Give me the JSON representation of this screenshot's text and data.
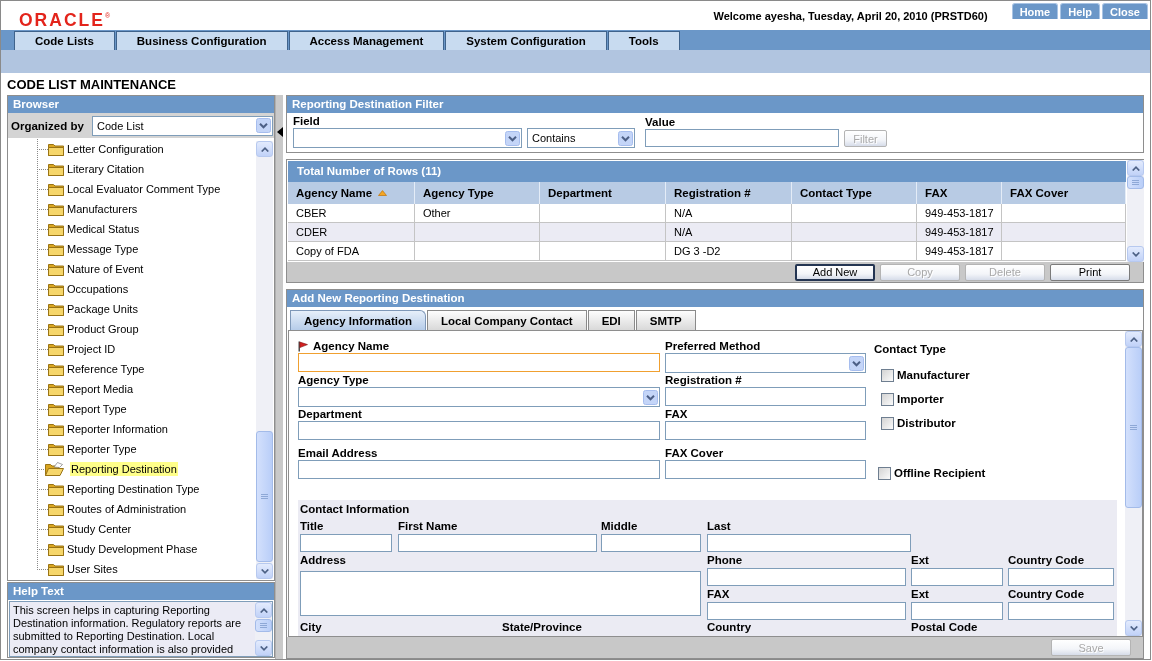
{
  "header": {
    "logo": "ORACLE$^{®}$",
    "welcome": "Welcome ayesha, Tuesday, April 20, 2010 (PRSTD60)",
    "links": [
      "Home",
      "Help",
      "Close"
    ]
  },
  "menu": [
    "Code Lists",
    "Business Configuration",
    "Access Management",
    "System Configuration",
    "Tools"
  ],
  "page_title": "CODE LIST MAINTENANCE",
  "browser": {
    "title": "Browser",
    "organized_by": {
      "label": "Organized by",
      "value": "Code List"
    },
    "items": [
      {
        "label": "Letter Configuration",
        "selected": false
      },
      {
        "label": "Literary Citation",
        "selected": false
      },
      {
        "label": "Local Evaluator Comment Type",
        "selected": false
      },
      {
        "label": "Manufacturers",
        "selected": false
      },
      {
        "label": "Medical Status",
        "selected": false
      },
      {
        "label": "Message Type",
        "selected": false
      },
      {
        "label": "Nature of Event",
        "selected": false
      },
      {
        "label": "Occupations",
        "selected": false
      },
      {
        "label": "Package Units",
        "selected": false
      },
      {
        "label": "Product Group",
        "selected": false
      },
      {
        "label": "Project ID",
        "selected": false
      },
      {
        "label": "Reference Type",
        "selected": false
      },
      {
        "label": "Report Media",
        "selected": false
      },
      {
        "label": "Report Type",
        "selected": false
      },
      {
        "label": "Reporter Information",
        "selected": false
      },
      {
        "label": "Reporter Type",
        "selected": false
      },
      {
        "label": "Reporting Destination",
        "selected": true
      },
      {
        "label": "Reporting Destination Type",
        "selected": false
      },
      {
        "label": "Routes of Administration",
        "selected": false
      },
      {
        "label": "Study Center",
        "selected": false
      },
      {
        "label": "Study Development Phase",
        "selected": false
      },
      {
        "label": "User Sites",
        "selected": false
      }
    ]
  },
  "help": {
    "title": "Help Text",
    "text": "This screen helps in capturing Reporting Destination information. Regulatory reports are submitted to Reporting Destination. Local company contact information is also provided"
  },
  "filter": {
    "title": "Reporting Destination Filter",
    "field_label": "Field",
    "operator": "Contains",
    "value_label": "Value",
    "button": {
      "label": "Filter",
      "disabled": true
    }
  },
  "table": {
    "title": "Total Number of Rows (11)",
    "columns": [
      {
        "label": "Agency Name",
        "sorted": true
      },
      {
        "label": "Agency Type",
        "sorted": false
      },
      {
        "label": "Department",
        "sorted": false
      },
      {
        "label": "Registration #",
        "sorted": false
      },
      {
        "label": "Contact Type",
        "sorted": false
      },
      {
        "label": "FAX",
        "sorted": false
      },
      {
        "label": "FAX Cover",
        "sorted": false
      }
    ],
    "rows": [
      [
        "CBER",
        "Other",
        null,
        "N/A",
        null,
        "949-453-1817",
        null
      ],
      [
        "CDER",
        null,
        null,
        "N/A",
        null,
        "949-453-1817",
        null
      ],
      [
        "Copy of FDA",
        null,
        null,
        "DG 3 -D2",
        null,
        "949-453-1817",
        null
      ]
    ],
    "buttons": [
      {
        "label": "Add New",
        "disabled": false,
        "focused": true
      },
      {
        "label": "Copy",
        "disabled": true,
        "focused": false
      },
      {
        "label": "Delete",
        "disabled": true,
        "focused": false
      },
      {
        "label": "Print",
        "disabled": false,
        "focused": false
      }
    ]
  },
  "form": {
    "title": "Add New Reporting Destination",
    "tabs": [
      {
        "label": "Agency Information",
        "selected": true
      },
      {
        "label": "Local Company Contact",
        "selected": false
      },
      {
        "label": "EDI",
        "selected": false
      },
      {
        "label": "SMTP",
        "selected": false
      }
    ],
    "fields": [
      {
        "label": "Agency Name",
        "kind": "text",
        "required": true,
        "focused": true
      },
      {
        "label": "Preferred Method",
        "kind": "select",
        "required": false,
        "focused": false
      },
      {
        "label": "Agency Type",
        "kind": "select",
        "required": false,
        "focused": false
      },
      {
        "label": "Registration #",
        "kind": "text",
        "required": false,
        "focused": false
      },
      {
        "label": "Department",
        "kind": "text",
        "required": false,
        "focused": false
      },
      {
        "label": "FAX",
        "kind": "text",
        "required": false,
        "focused": false
      },
      {
        "label": "Email Address",
        "kind": "text",
        "required": false,
        "focused": false
      },
      {
        "label": "FAX Cover",
        "kind": "text",
        "required": false,
        "focused": false
      }
    ],
    "contact_type": {
      "label": "Contact Type",
      "options": [
        {
          "label": "Manufacturer",
          "checked": false
        },
        {
          "label": "Importer",
          "checked": false
        },
        {
          "label": "Distributor",
          "checked": false
        }
      ]
    },
    "offline_recipient": {
      "label": "Offline Recipient",
      "checked": false
    },
    "contact_information": {
      "title": "Contact Information",
      "name_fields": [
        "Title",
        "First Name",
        "Middle",
        "Last"
      ],
      "address_label": "Address",
      "phone_fields": [
        "Phone",
        "Ext",
        "Country Code"
      ],
      "fax_fields": [
        "FAX",
        "Ext",
        "Country Code"
      ],
      "location_fields": [
        "City",
        "State/Province",
        "Country",
        "Postal Code"
      ]
    },
    "save": {
      "label": "Save",
      "disabled": true
    }
  }
}
